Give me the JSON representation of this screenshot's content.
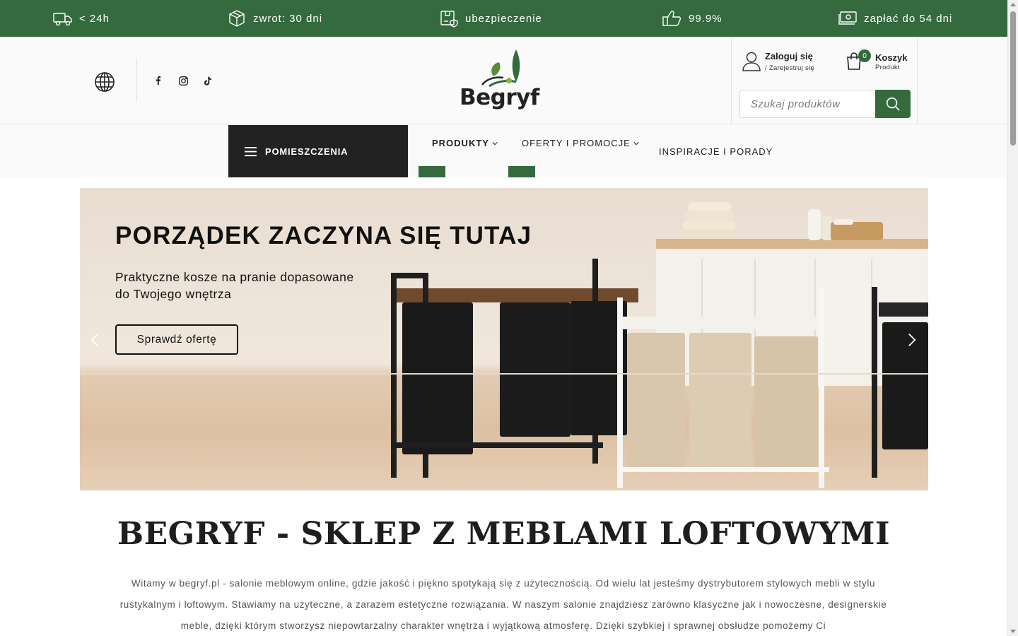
{
  "topbar": {
    "perks": [
      {
        "icon": "truck-icon",
        "label": "< 24h"
      },
      {
        "icon": "box-icon",
        "label": "zwrot: 30 dni"
      },
      {
        "icon": "insured-package-icon",
        "label": "ubezpieczenie"
      },
      {
        "icon": "thumbs-up-icon",
        "label": "99.9%"
      },
      {
        "icon": "cash-icon",
        "label": "zapłać do 54 dni"
      }
    ]
  },
  "header": {
    "logo": "Begryf",
    "account": {
      "title": "Zaloguj się",
      "subtitle": "/ Zarejestruj się"
    },
    "cart": {
      "count": "0",
      "title": "Koszyk",
      "subtitle": "Produkt"
    },
    "search": {
      "placeholder": "Szukaj produktów"
    }
  },
  "nav": {
    "rooms": "POMIESZCZENIA",
    "items": [
      "PRODUKTY",
      "OFERTY I PROMOCJE",
      "INSPIRACJE I PORADY"
    ]
  },
  "hero": {
    "title": "PORZĄDEK ZACZYNA SIĘ TUTAJ",
    "subtitle_line1": "Praktyczne kosze na pranie dopasowane",
    "subtitle_line2": "do Twojego wnętrza",
    "cta": "Sprawdź ofertę"
  },
  "main": {
    "title": "BEGRYF - SKLEP Z MEBLAMI LOFTOWYMI",
    "intro": "Witamy w begryf.pl - salonie meblowym online, gdzie jakość i piękno spotykają się z użytecznością. Od wielu lat jesteśmy dystrybutorem stylowych mebli w stylu rustykalnym i loftowym. Stawiamy na użyteczne, a zarazem estetyczne rozwiązania. W naszym salonie znajdziesz zarówno klasyczne jak i nowoczesne, designerskie meble, dzięki którym stworzysz niepowtarzalny charakter wnętrza i wyjątkową atmosferę. Dzięki szybkiej i sprawnej obsłudze pomożemy Ci"
  },
  "colors": {
    "brand_green": "#346a3e",
    "dark": "#222222"
  }
}
